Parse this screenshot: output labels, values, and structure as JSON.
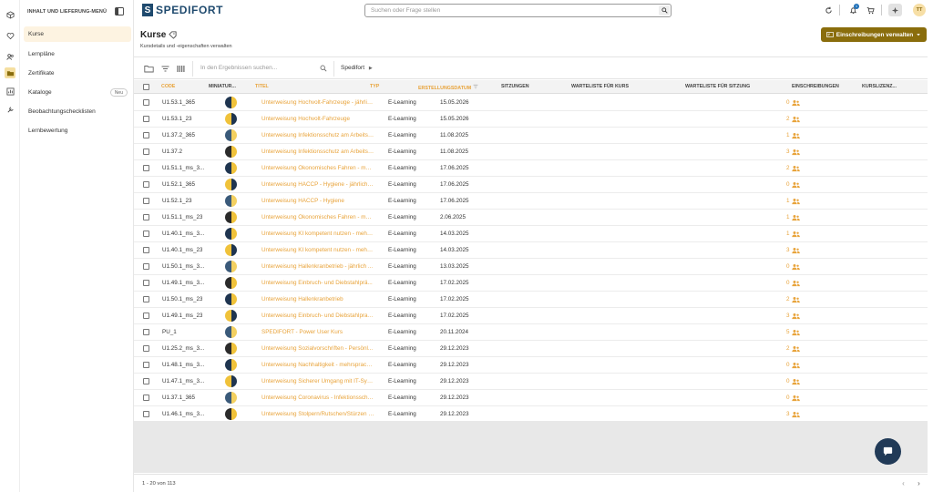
{
  "sidebar": {
    "header": "INHALT UND LIEFERUNG-MENÜ",
    "items": [
      {
        "label": "Kurse",
        "active": true
      },
      {
        "label": "Lernpläne"
      },
      {
        "label": "Zertifikate"
      },
      {
        "label": "Kataloge",
        "badge": "Neu"
      },
      {
        "label": "Beobachtungschecklisten"
      },
      {
        "label": "Lernbewertung"
      }
    ]
  },
  "brand": {
    "mark": "S",
    "name": "SPEDIFORT",
    "color": "#1f4a6e"
  },
  "search": {
    "placeholder": "Suchen oder Frage stellen"
  },
  "topbar": {
    "notification_count": "1",
    "avatar_initials": "TT"
  },
  "page": {
    "title": "Kurse",
    "subtitle": "Kursdetails und -eigenschaften verwalten",
    "manage_button": "Einschreibungen verwalten"
  },
  "toolbar": {
    "search_placeholder": "In den Ergebnissen suchen...",
    "breadcrumb": "Spedifort"
  },
  "table": {
    "columns": [
      "CODE",
      "MINIATUR...",
      "TITEL",
      "TYP",
      "ERSTELLUNGSDATUM",
      "SITZUNGEN",
      "WARTELISTE FÜR KURS",
      "WARTELISTE FÜR SITZUNG",
      "EINSCHREIBUNGEN",
      "KURSLIZENZ..."
    ],
    "rows": [
      {
        "code": "U1.53.1_365",
        "title": "Unterweisung Hochvolt-Fahrzeuge - jährlich ...",
        "type": "E-Learning",
        "date": "15.05.2026",
        "enrollments": "0"
      },
      {
        "code": "U1.53.1_23",
        "title": "Unterweisung Hochvolt-Fahrzeuge",
        "type": "E-Learning",
        "date": "15.05.2026",
        "enrollments": "2"
      },
      {
        "code": "U1.37.2_365",
        "title": "Unterweisung Infektionsschutz am Arbeitsp...",
        "type": "E-Learning",
        "date": "11.08.2025",
        "enrollments": "1"
      },
      {
        "code": "U1.37.2",
        "title": "Unterweisung Infektionsschutz am Arbeitsp...",
        "type": "E-Learning",
        "date": "11.08.2025",
        "enrollments": "3"
      },
      {
        "code": "U1.51.1_ms_3...",
        "title": "Unterweisung Ökonomisches Fahren - mehr...",
        "type": "E-Learning",
        "date": "17.06.2025",
        "enrollments": "2"
      },
      {
        "code": "U1.52.1_365",
        "title": "Unterweisung HACCP - Hygiene - jährlich w...",
        "type": "E-Learning",
        "date": "17.06.2025",
        "enrollments": "0"
      },
      {
        "code": "U1.52.1_23",
        "title": "Unterweisung HACCP - Hygiene",
        "type": "E-Learning",
        "date": "17.06.2025",
        "enrollments": "1"
      },
      {
        "code": "U1.51.1_ms_23",
        "title": "Unterweisung Ökonomisches Fahren - mehr...",
        "type": "E-Learning",
        "date": "2.06.2025",
        "enrollments": "1"
      },
      {
        "code": "U1.40.1_ms_3...",
        "title": "Unterweisung KI kompetent nutzen - mehrs...",
        "type": "E-Learning",
        "date": "14.03.2025",
        "enrollments": "1"
      },
      {
        "code": "U1.40.1_ms_23",
        "title": "Unterweisung KI kompetent nutzen - mehrs...",
        "type": "E-Learning",
        "date": "14.03.2025",
        "enrollments": "3"
      },
      {
        "code": "U1.50.1_ms_3...",
        "title": "Unterweisung Hallenkranbetrieb - jährlich ...",
        "type": "E-Learning",
        "date": "13.03.2025",
        "enrollments": "0"
      },
      {
        "code": "U1.49.1_ms_3...",
        "title": "Unterweisung Einbruch- und Diebstahlprä...",
        "type": "E-Learning",
        "date": "17.02.2025",
        "enrollments": "0"
      },
      {
        "code": "U1.50.1_ms_23",
        "title": "Unterweisung Hallenkranbetrieb",
        "type": "E-Learning",
        "date": "17.02.2025",
        "enrollments": "2"
      },
      {
        "code": "U1.49.1_ms_23",
        "title": "Unterweisung Einbruch- und Diebstahlprav...",
        "type": "E-Learning",
        "date": "17.02.2025",
        "enrollments": "3"
      },
      {
        "code": "PU_1",
        "title": "SPEDIFORT - Power User Kurs",
        "type": "E-Learning",
        "date": "20.11.2024",
        "enrollments": "5"
      },
      {
        "code": "U1.25.2_ms_3...",
        "title": "Unterweisung Sozialvorschriften - Persönl...",
        "type": "E-Learning",
        "date": "29.12.2023",
        "enrollments": "2"
      },
      {
        "code": "U1.48.1_ms_3...",
        "title": "Unterweisung Nachhaltigkeit - mehrsprachi...",
        "type": "E-Learning",
        "date": "29.12.2023",
        "enrollments": "0"
      },
      {
        "code": "U1.47.1_ms_3...",
        "title": "Unterweisung Sicherer Umgang mit IT-Syste...",
        "type": "E-Learning",
        "date": "29.12.2023",
        "enrollments": "0"
      },
      {
        "code": "U1.37.1_365",
        "title": "Unterweisung Coronavirus - Infektionsschut...",
        "type": "E-Learning",
        "date": "29.12.2023",
        "enrollments": "0"
      },
      {
        "code": "U1.46.1_ms_3...",
        "title": "Unterweisung Stolpern/Rutschen/Stürzen - ...",
        "type": "E-Learning",
        "date": "29.12.2023",
        "enrollments": "3"
      }
    ]
  },
  "pagination": {
    "summary": "1 - 20 von 113"
  },
  "colors": {
    "accent": "#e8a33a",
    "primary_button": "#8a6d0c",
    "chat": "#213a57"
  }
}
